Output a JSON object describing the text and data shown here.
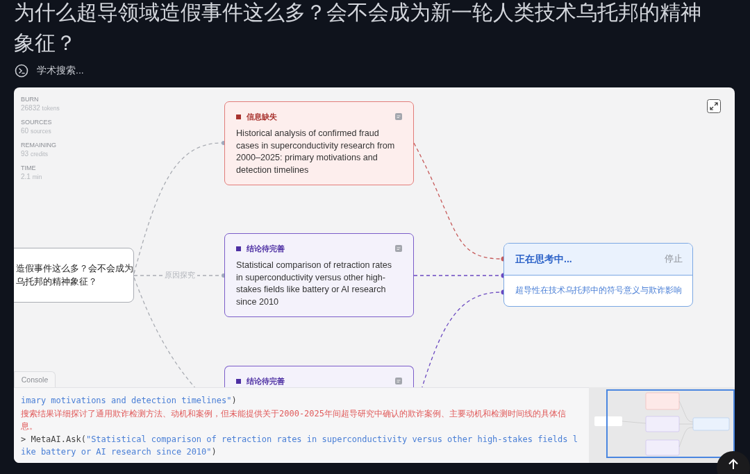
{
  "title": "为什么超导领域造假事件这么多？会不会成为新一轮人类技术乌托邦的精神象征？",
  "status": {
    "label": "学术搜索..."
  },
  "stats": [
    {
      "label": "BURN",
      "value": "26832",
      "unit": "tokens"
    },
    {
      "label": "SOURCES",
      "value": "60",
      "unit": "sources"
    },
    {
      "label": "REMAINING",
      "value": "93",
      "unit": "credits"
    },
    {
      "label": "TIME",
      "value": "2.1",
      "unit": "min"
    }
  ],
  "root_node": {
    "text": "造假事件这么多？会不会成为乌托邦的精神象征？"
  },
  "edge_label": "原因探究",
  "cards": [
    {
      "kind": "gap",
      "tag": "信息缺失",
      "text": "Historical analysis of confirmed fraud cases in superconductivity research from 2000–2025: primary motivations and detection timelines"
    },
    {
      "kind": "refine",
      "tag": "结论待完善",
      "text": "Statistical comparison of retraction rates in superconductivity versus other high-stakes fields like battery or AI research since 2010"
    },
    {
      "kind": "refine",
      "tag": "结论待完善"
    }
  ],
  "thinking_node": {
    "title": "正在思考中...",
    "stop_button": "停止",
    "query": "超导性在技术乌托邦中的符号意义与欺诈影响"
  },
  "console": {
    "tab": "Console",
    "lines": [
      {
        "kind": "call",
        "arg": "imary motivations and detection timelines\"",
        "suffix": ")"
      },
      {
        "kind": "error",
        "text": "搜索结果详细探讨了通用欺诈检测方法、动机和案例，但未能提供关于2000-2025年间超导研究中确认的欺诈案例、主要动机和检测时间线的具体信息。"
      },
      {
        "kind": "call",
        "prefix": "> MetaAI.Ask(",
        "arg": "\"Statistical comparison of retraction rates in superconductivity versus other high-stakes fields like battery or AI research since 2010\"",
        "suffix": ")"
      }
    ]
  }
}
